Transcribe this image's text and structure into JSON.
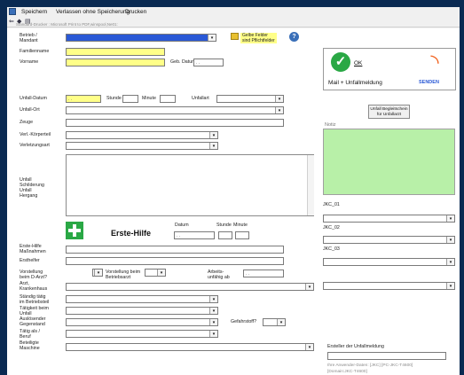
{
  "menu": {
    "save": "Speichern",
    "exit_no_save": "Verlassen ohne Speicherung",
    "print": "Drucken"
  },
  "breadcrumb": "Standard-Drucker : Microsoft Print to PDF,winspool,Ne01:",
  "fields": {
    "betrieb_label": "Betrieb /\nMandant",
    "familienname_label": "Familienname",
    "vorname_label": "Vorname",
    "geb_datum_label": "Geb. Datum",
    "geb_datum_value": ". .",
    "unfall_datum_label": "Unfall-Datum",
    "unfall_datum_value": ". .",
    "stunde_label": "Stunde",
    "minute_label": "Minute",
    "unfallart_label": "Unfallart",
    "unfall_ort_label": "Unfall-Ort",
    "zeuge_label": "Zeuge",
    "verl_koerperteil_label": "Verl.-Körperteil",
    "verletzungsart_label": "Verletzungsart",
    "schilderung_label": "Unfall\nSchilderung\nUnfall\nHergang",
    "erste_hilfe_massnahmen_label": "Erste-Hilfe\nMaßnahmen",
    "ersthelfer_label": "Ersthelfer",
    "vorstellung_darzt_label": "Vorstellung\nbeim D-Arzt?",
    "vorstellung_betriebsarzt_label": "Vorstellung beim\nBetriebsarzt",
    "arbeitsunfaehig_label": "Arbeits-\nunfähig ab",
    "arbeitsunfaehig_value": ". .",
    "krankenhaus_label": "Arzt,\nKrankenhaus",
    "taetig_betrieb_label": "Ständig tätig\nim Betriebsteil",
    "taetigkeit_label": "Tätigkeit beim\nUnfall",
    "gegenstand_label": "Auslösender\nGegenstand",
    "gefahrstoff_label": "Gefahrstoff?",
    "taetig_als_label": "Tätig als /\nBeruf",
    "maschine_label": "Beteiligte\nMaschine"
  },
  "erste_hilfe": {
    "title": "Erste-Hilfe",
    "datum_label": "Datum",
    "stunde_label": "Stunde",
    "minute_label": "Minute",
    "datum_value": ". ."
  },
  "pflicht_hint": "Gelbe Felder\nsind Pflichtfelder",
  "right_panel": {
    "ok_label": "OK",
    "senden_label": "Mail + Unfallmeldung",
    "senden_badge": "SENDEN",
    "begleitschein_button": "Unfall Begleitschein\nfür Unfallarzt",
    "notiz_label": "Notiz",
    "jkc_01": "JKC_01",
    "jkc_02": "JKC_02",
    "jkc_03": "JKC_03",
    "ersteller_label": "Ersteller der Unfallmeldung",
    "footer_line1": "Ihre Anwender-Daten: [JKC] [PC-JKC-T4600]",
    "footer_line2": "[Domain:JKC-T4600]"
  },
  "colors": {
    "required_yellow": "#ffff88",
    "selected_blue": "#2a59d6",
    "note_green": "#b8f0a8",
    "rss_orange": "#f26522"
  }
}
